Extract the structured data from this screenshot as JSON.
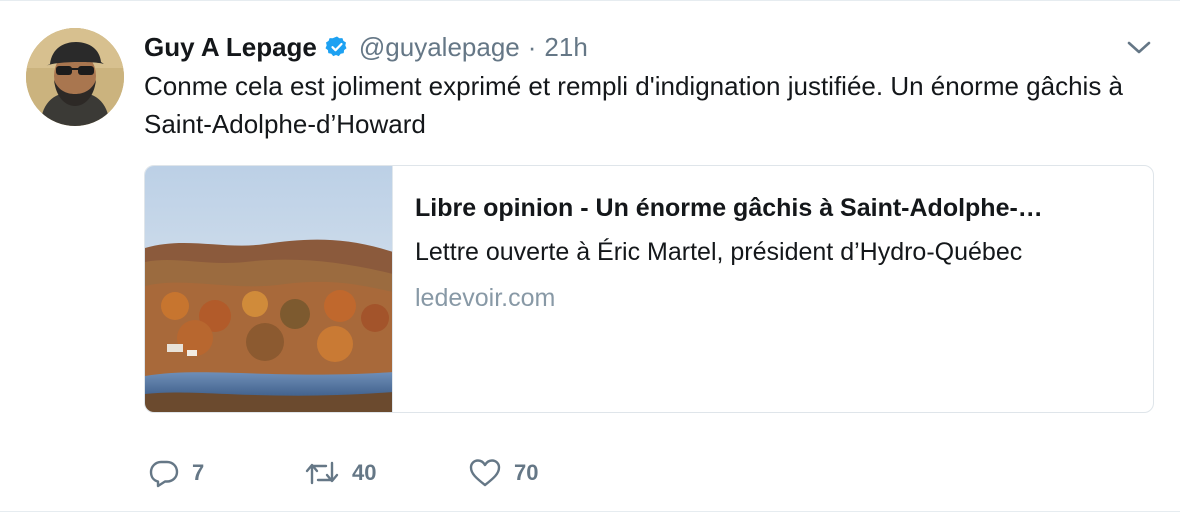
{
  "tweet": {
    "author": {
      "name": "Guy A Lepage",
      "handle": "@guyalepage",
      "verified": true
    },
    "separator": "·",
    "time": "21h",
    "text": "Conme cela est joliment exprimé et rempli d'indignation justifiée. Un énorme gâchis à Saint-Adolphe-d’Howard",
    "card": {
      "title": "Libre opinion - Un énorme gâchis à Saint-Adolphe-…",
      "description": "Lettre ouverte à Éric Martel, président d’Hydro-Québec",
      "domain": "ledevoir.com"
    },
    "actions": {
      "reply_count": "7",
      "retweet_count": "40",
      "like_count": "70"
    }
  },
  "colors": {
    "text_primary": "#14171a",
    "text_secondary": "#657786",
    "domain": "#8899a6",
    "verified": "#1da1f2",
    "border": "#e1e8ed"
  },
  "icons": {
    "verified": "verified-badge-icon",
    "caret": "chevron-down-icon",
    "reply": "reply-icon",
    "retweet": "retweet-icon",
    "like": "heart-icon"
  }
}
